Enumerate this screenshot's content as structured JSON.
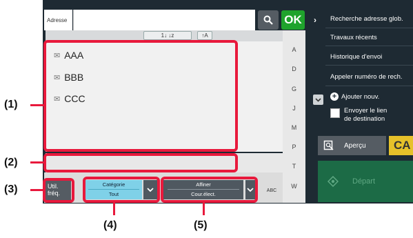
{
  "address": {
    "label": "Adresse",
    "value": ""
  },
  "toolbar": {
    "ok_label": "OK",
    "sort_a": "1↓ ↓z",
    "sort_b": "↑A"
  },
  "list": {
    "items": [
      "AAA",
      "BBB",
      "CCC"
    ]
  },
  "index": {
    "letters": [
      "A",
      "D",
      "G",
      "J",
      "M",
      "P",
      "T",
      "W"
    ],
    "abc_label": "ABC"
  },
  "bottom": {
    "freq_label_1": "Util.",
    "freq_label_2": "fréq.",
    "category_label": "Catégorie",
    "category_value": "Tout",
    "refine_label": "Affiner",
    "refine_value": "Cour.élect."
  },
  "right_panel": {
    "items": [
      "Recherche adresse glob.",
      "Travaux récents",
      "Historique d'envoi",
      "Appeler numéro de rech."
    ],
    "add_new": "Ajouter nouv.",
    "send_link_1": "Envoyer le lien",
    "send_link_2": "de destination",
    "preview_label": "Aperçu",
    "ca_label": "CA",
    "start_label": "Départ"
  },
  "callouts": {
    "c1": "(1)",
    "c2": "(2)",
    "c3": "(3)",
    "c4": "(4)",
    "c5": "(5)"
  },
  "colors": {
    "highlight": "#e8193c",
    "ok_green": "#1fa32c",
    "category_cyan": "#7fd1e8",
    "start_green": "#1c6b46",
    "ca_yellow": "#e6c12a"
  }
}
